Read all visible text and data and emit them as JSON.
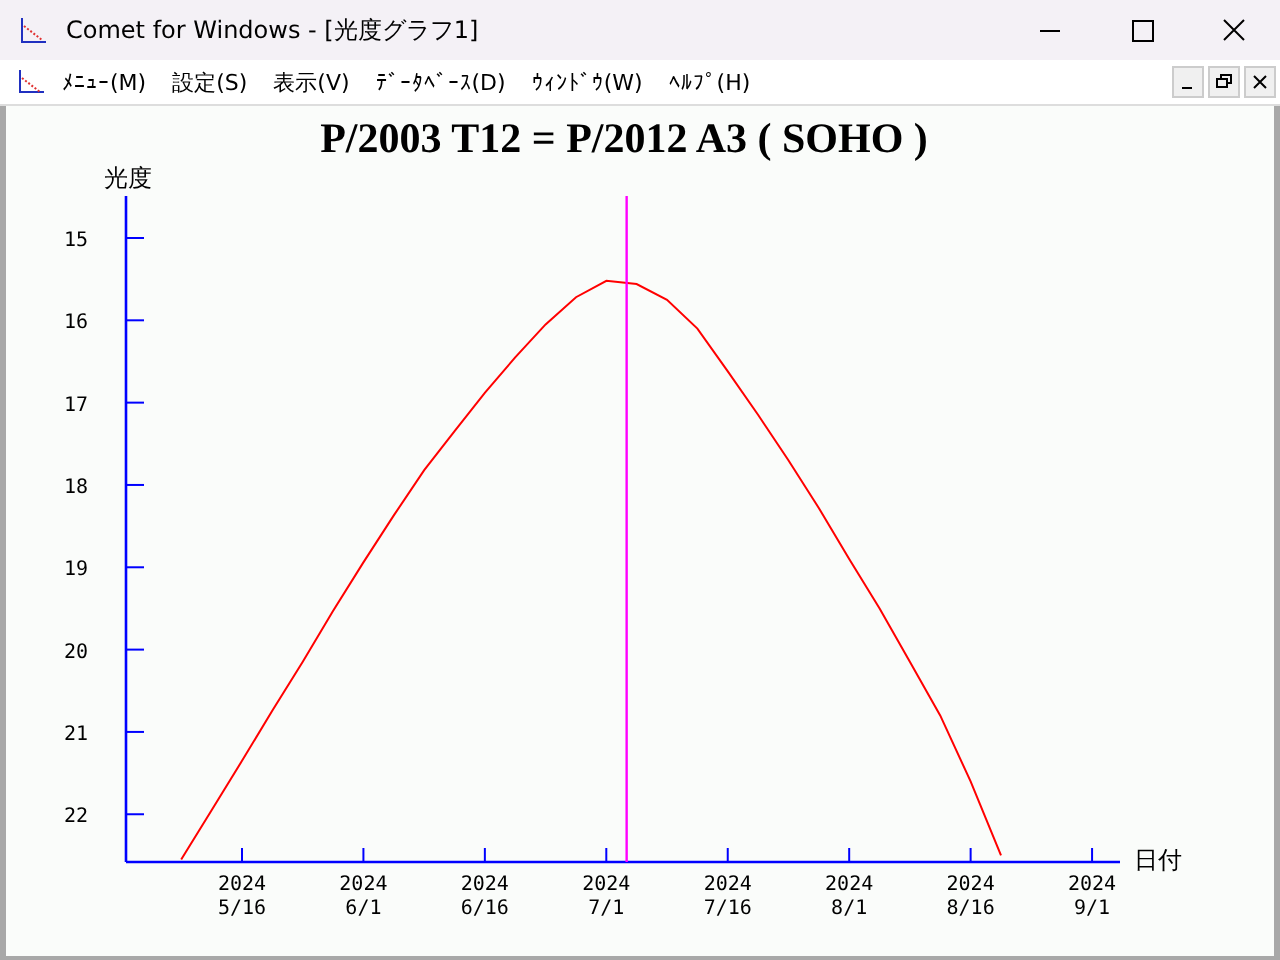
{
  "window": {
    "title": "Comet for Windows - [光度グラフ1]"
  },
  "menu": [
    {
      "label": "ﾒﾆｭｰ(M)"
    },
    {
      "label": "設定(S)"
    },
    {
      "label": "表示(V)"
    },
    {
      "label": "ﾃﾞｰﾀﾍﾞｰｽ(D)"
    },
    {
      "label": "ｳｨﾝﾄﾞｳ(W)"
    },
    {
      "label": "ﾍﾙﾌﾟ(H)"
    }
  ],
  "graph": {
    "chart_data": {
      "type": "line",
      "title": "P/2003 T12 = P/2012 A3 ( SOHO )",
      "xlabel": "日付",
      "ylabel": "光度",
      "ylim": [
        22.58,
        14.49
      ],
      "categories": [
        null,
        null,
        "2024\n5/16",
        null,
        null,
        null,
        "2024\n6/1",
        null,
        null,
        null,
        "2024\n6/16",
        null,
        null,
        null,
        "2024\n7/1",
        null,
        null,
        null,
        "2024\n7/16",
        null,
        null,
        null,
        "2024\n8/1",
        null,
        null,
        null,
        "2024\n8/16",
        null,
        null,
        null,
        "2024\n9/1"
      ],
      "yticks": [
        15,
        16,
        17,
        18,
        19,
        20,
        21,
        22
      ],
      "series": [
        {
          "color": "#ff0000",
          "values": [
            22.55,
            21.95,
            21.35,
            20.74,
            20.15,
            19.53,
            18.94,
            18.37,
            17.82,
            17.35,
            16.88,
            16.45,
            16.05,
            15.72,
            15.52,
            15.56,
            15.75,
            16.1,
            16.62,
            17.15,
            17.7,
            18.28,
            18.9,
            19.5,
            20.15,
            20.8,
            21.6,
            22.5,
            null,
            null,
            null
          ]
        }
      ]
    }
  }
}
